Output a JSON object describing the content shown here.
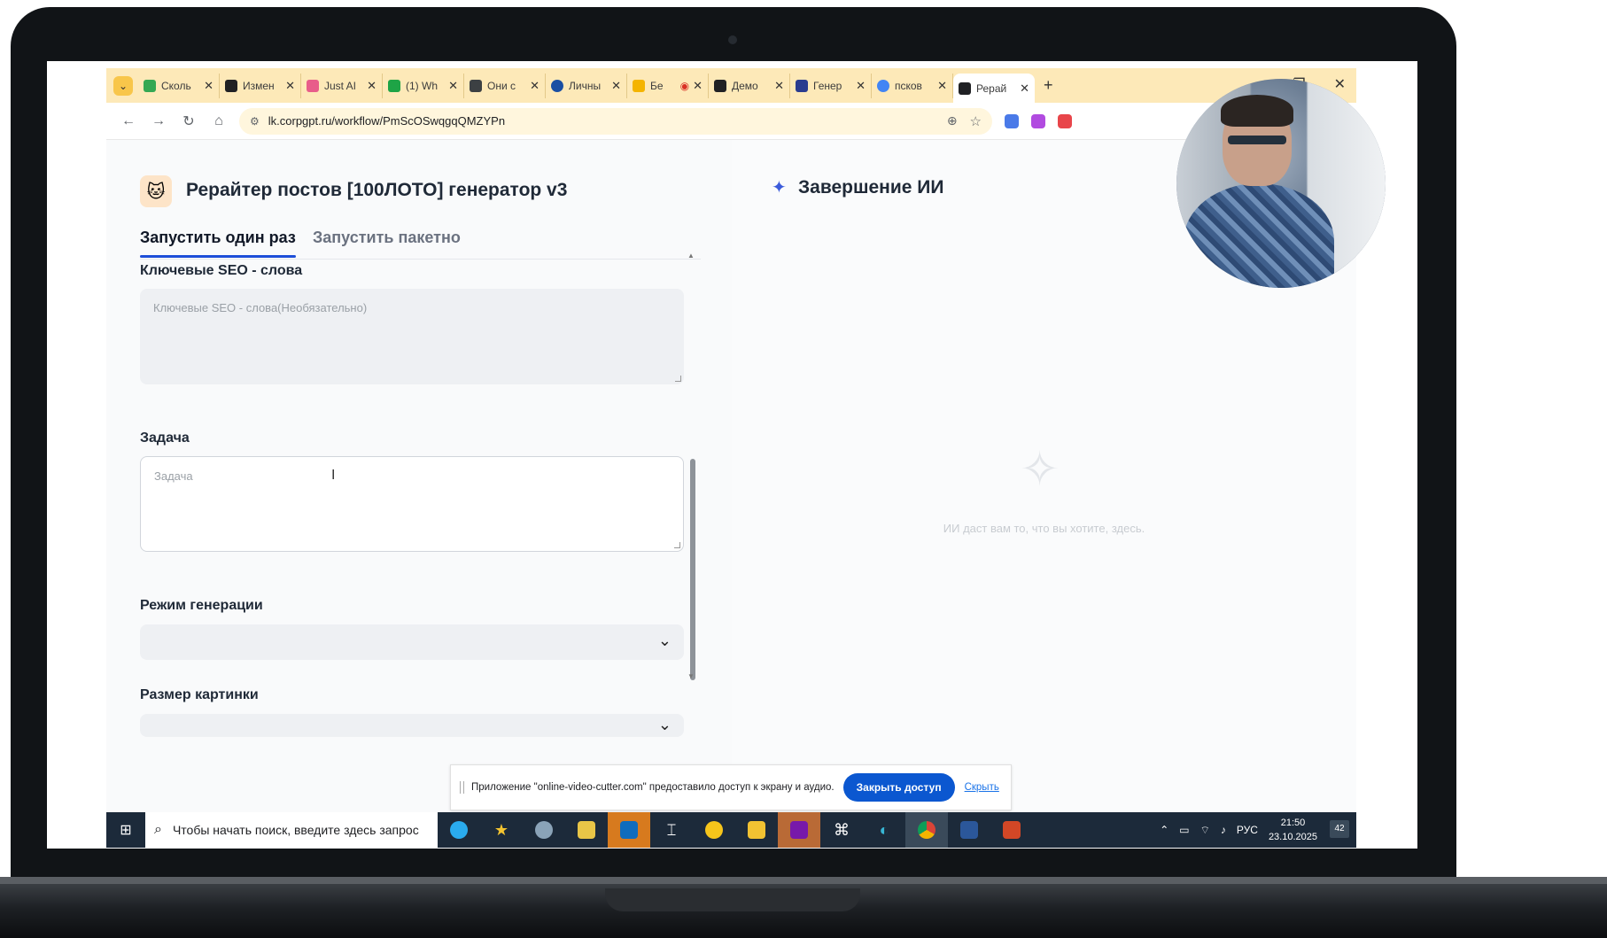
{
  "browser": {
    "tabs": [
      {
        "label": "Сколь",
        "color": "#34a853"
      },
      {
        "label": "Измен",
        "color": "#202124"
      },
      {
        "label": "Just AI",
        "color": "#e85d8a"
      },
      {
        "label": "(1) Wh",
        "color": "#1ea446"
      },
      {
        "label": "Они с",
        "color": "#3c4043"
      },
      {
        "label": "Личны",
        "color": "#1a4fa3"
      },
      {
        "label": "Бе",
        "color": "#f4b400"
      },
      {
        "label": "Демо",
        "color": "#202124"
      },
      {
        "label": "Генер",
        "color": "#2a3c8f"
      },
      {
        "label": "псков",
        "color": "#4285f4"
      },
      {
        "label": "Рерай",
        "color": "#202124"
      }
    ],
    "url": "lk.corpgpt.ru/workflow/PmScOSwqgqQMZYPn"
  },
  "app": {
    "title": "Рерайтер постов [100ЛОТО] генератор v3",
    "run_tabs": {
      "once": "Запустить один раз",
      "batch": "Запустить пакетно"
    },
    "fields": {
      "seo_label": "Ключевые SEO - слова",
      "seo_placeholder": "Ключевые SEO - слова(Необязательно)",
      "task_label": "Задача",
      "task_placeholder": "Задача",
      "mode_label": "Режим генерации",
      "size_label": "Размер картинки"
    }
  },
  "result": {
    "title": "Завершение ИИ",
    "empty_hint": "ИИ даст вам то, что вы хотите, здесь."
  },
  "sharebar": {
    "message": "Приложение \"online-video-cutter.com\" предоставило доступ к экрану и аудио.",
    "stop_button": "Закрыть доступ",
    "hide_link": "Скрыть"
  },
  "taskbar": {
    "search_placeholder": "Чтобы начать поиск, введите здесь запрос",
    "language": "РУС",
    "time": "21:50",
    "date": "23.10.2025",
    "notifications": "42"
  }
}
